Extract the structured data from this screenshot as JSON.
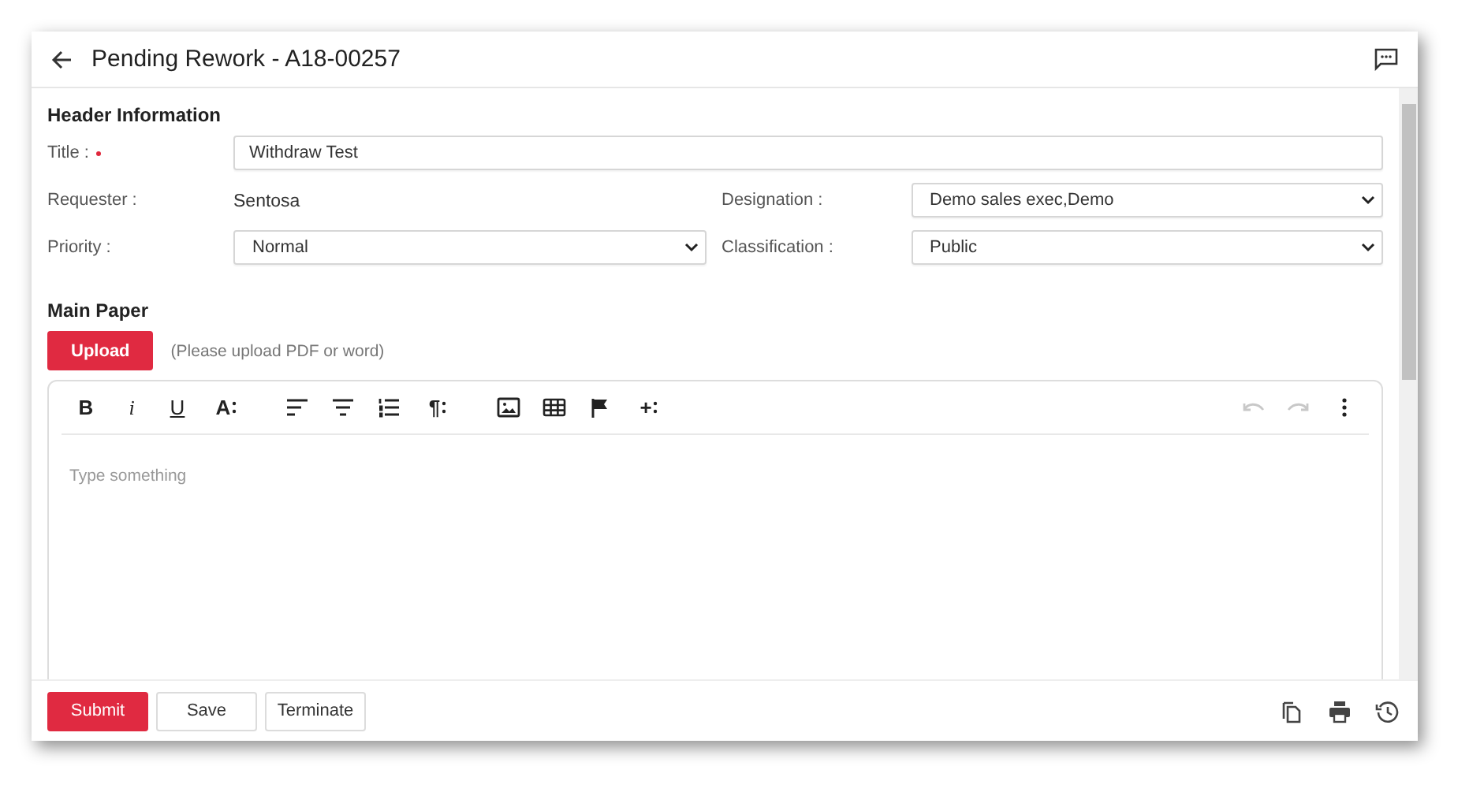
{
  "header": {
    "title": "Pending Rework - A18-00257"
  },
  "section": {
    "title": "Header Information",
    "fields": [
      {
        "label": "Title :",
        "required": true,
        "kind": "input",
        "value": "Withdraw Test"
      },
      {
        "label": "Requester :",
        "required": false,
        "kind": "static",
        "value": "Sentosa"
      },
      {
        "label": "Designation :",
        "required": false,
        "kind": "select",
        "value": "Demo sales exec,Demo"
      },
      {
        "label": "Priority :",
        "required": false,
        "kind": "select",
        "value": "Normal"
      },
      {
        "label": "Classification :",
        "required": false,
        "kind": "select",
        "value": "Public"
      }
    ]
  },
  "main_paper": {
    "title": "Main Paper",
    "upload_button": "Upload",
    "hint": "(Please upload PDF or word)",
    "editor": {
      "placeholder": "Type something",
      "toolbar": [
        [
          {
            "kind": "bold",
            "label": "B"
          },
          {
            "kind": "italic",
            "label": "i"
          },
          {
            "kind": "underline",
            "label": "U"
          },
          {
            "kind": "menu",
            "label": "A"
          }
        ],
        [
          {
            "kind": "align-left"
          },
          {
            "kind": "align-center"
          },
          {
            "kind": "ordered-list"
          },
          {
            "kind": "menu",
            "label": "¶"
          }
        ],
        [
          {
            "kind": "image"
          },
          {
            "kind": "table"
          },
          {
            "kind": "flag"
          },
          {
            "kind": "menu",
            "label": "+"
          }
        ]
      ],
      "history": [
        {
          "kind": "undo",
          "disabled": true
        },
        {
          "kind": "redo",
          "disabled": true
        },
        {
          "kind": "more",
          "disabled": false
        }
      ]
    }
  },
  "footer": {
    "buttons": [
      {
        "label": "Submit",
        "primary": true
      },
      {
        "label": "Save",
        "primary": false
      },
      {
        "label": "Terminate",
        "primary": false
      }
    ],
    "icons": [
      {
        "kind": "copy"
      },
      {
        "kind": "print"
      },
      {
        "kind": "history"
      }
    ]
  }
}
